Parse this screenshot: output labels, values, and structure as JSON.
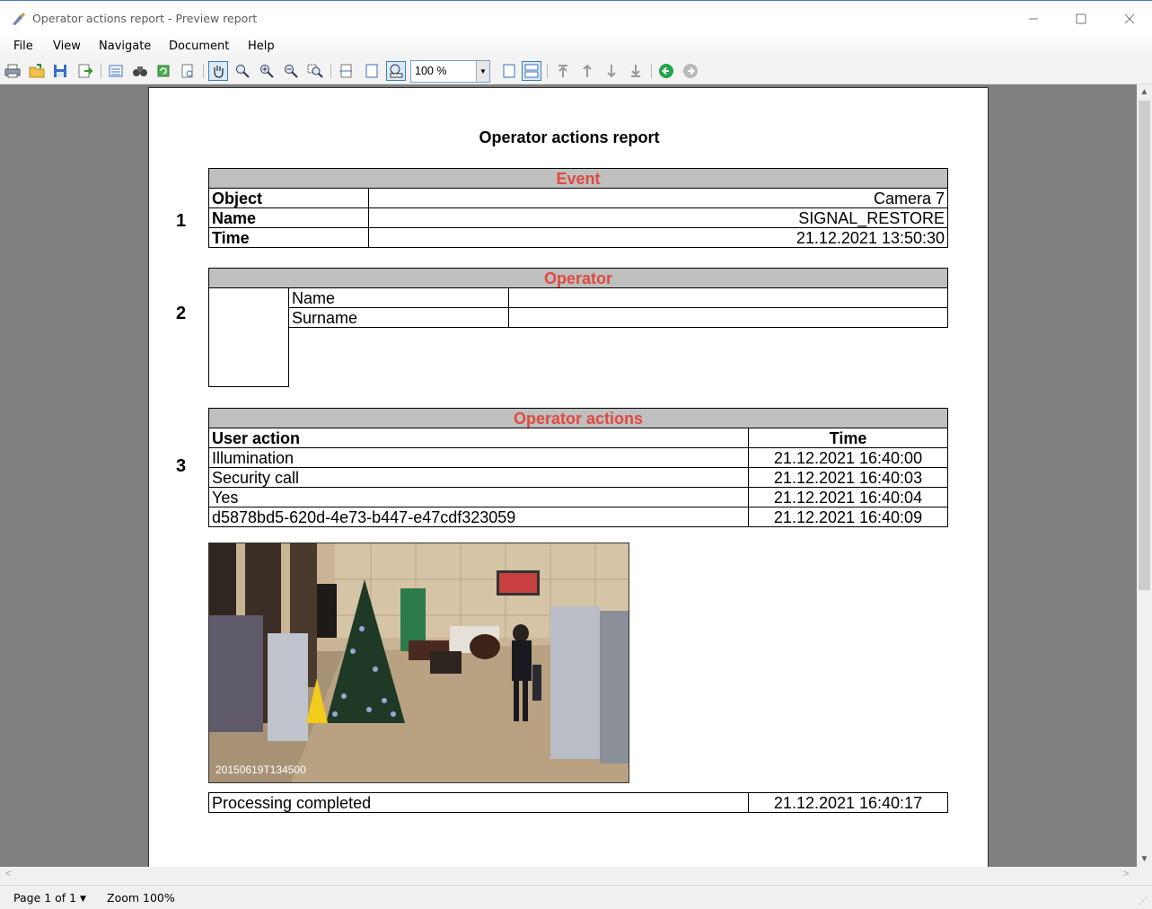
{
  "window": {
    "title": "Operator actions report - Preview report"
  },
  "menu": {
    "items": [
      "File",
      "View",
      "Navigate",
      "Document",
      "Help"
    ]
  },
  "toolbar": {
    "zoom_value": "100 %"
  },
  "report": {
    "title": "Operator actions report",
    "section1": {
      "number": "1",
      "header": "Event",
      "rows": [
        {
          "label": "Object",
          "value": "Camera 7"
        },
        {
          "label": "Name",
          "value": "SIGNAL_RESTORE"
        },
        {
          "label": "Time",
          "value": "21.12.2021 13:50:30"
        }
      ]
    },
    "section2": {
      "number": "2",
      "header": "Operator",
      "rows": [
        {
          "label": "Name",
          "value": ""
        },
        {
          "label": "Surname",
          "value": ""
        }
      ]
    },
    "section3": {
      "number": "3",
      "header": "Operator actions",
      "col_action": "User action",
      "col_time": "Time",
      "rows": [
        {
          "action": "Illumination",
          "time": "21.12.2021 16:40:00"
        },
        {
          "action": "Security call",
          "time": "21.12.2021 16:40:03"
        },
        {
          "action": "Yes",
          "time": "21.12.2021 16:40:04"
        },
        {
          "action": "d5878bd5-620d-4e73-b447-e47cdf323059",
          "time": "21.12.2021 16:40:09"
        }
      ]
    },
    "snapshot": {
      "timestamp": "20150619T134500"
    },
    "footer": {
      "status": "Processing completed",
      "time": "21.12.2021 16:40:17"
    }
  },
  "statusbar": {
    "page": "Page 1 of 1",
    "zoom": "Zoom 100%"
  },
  "colors": {
    "header_text": "#e04a3f",
    "header_bg": "#bfbfbf",
    "viewport_bg": "#7f7f7f"
  }
}
